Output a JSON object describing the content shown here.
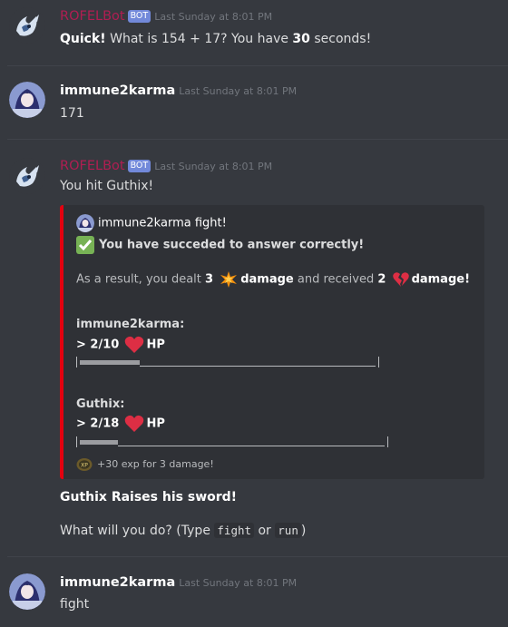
{
  "messages": [
    {
      "author": "ROFELBot",
      "bot_tag": "BOT",
      "timestamp": "Last Sunday at 8:01 PM",
      "text": {
        "quick": "Quick!",
        "question": " What is 154 + 17?  You have ",
        "seconds": "30",
        "tail": " seconds!"
      }
    },
    {
      "author": "immune2karma",
      "timestamp": "Last Sunday at 8:01 PM",
      "text": "171"
    },
    {
      "author": "ROFELBot",
      "bot_tag": "BOT",
      "timestamp": "Last Sunday at 8:01 PM",
      "text": "You hit Guthix!",
      "embed": {
        "accent_color": "#e3000f",
        "author": "immune2karma fight!",
        "title": "You have succeded to answer correctly!",
        "result": {
          "prefix": "As a result, you dealt ",
          "dealt": "3",
          "damage_word": "damage",
          "received_prefix": " and received ",
          "received": "2",
          "damage_word2": "damage!"
        },
        "player": {
          "name": "immune2karma:",
          "hp_value": "> 2/10",
          "hp_label": "HP",
          "hp_fraction": 0.2,
          "bar_text": "|▬▬▬▬▬▬▬▬▬_______________________________________________|"
        },
        "enemy": {
          "name": "Guthix:",
          "hp_value": "> 2/18",
          "hp_label": "HP",
          "hp_fraction": 0.11,
          "bar_text": "|▬▬▬▬▬▬▬____________________________________________________|"
        },
        "footer": "+30 exp for 3 damage!",
        "footer_icon_label": "XP"
      },
      "after": {
        "line1": "Guthix Raises his sword!",
        "prompt_prefix": "What will you do? (Type ",
        "cmd1": "fight",
        "or": " or ",
        "cmd2": "run",
        "suffix": ")"
      }
    },
    {
      "author": "immune2karma",
      "timestamp": "Last Sunday at 8:01 PM",
      "text": "fight"
    }
  ]
}
